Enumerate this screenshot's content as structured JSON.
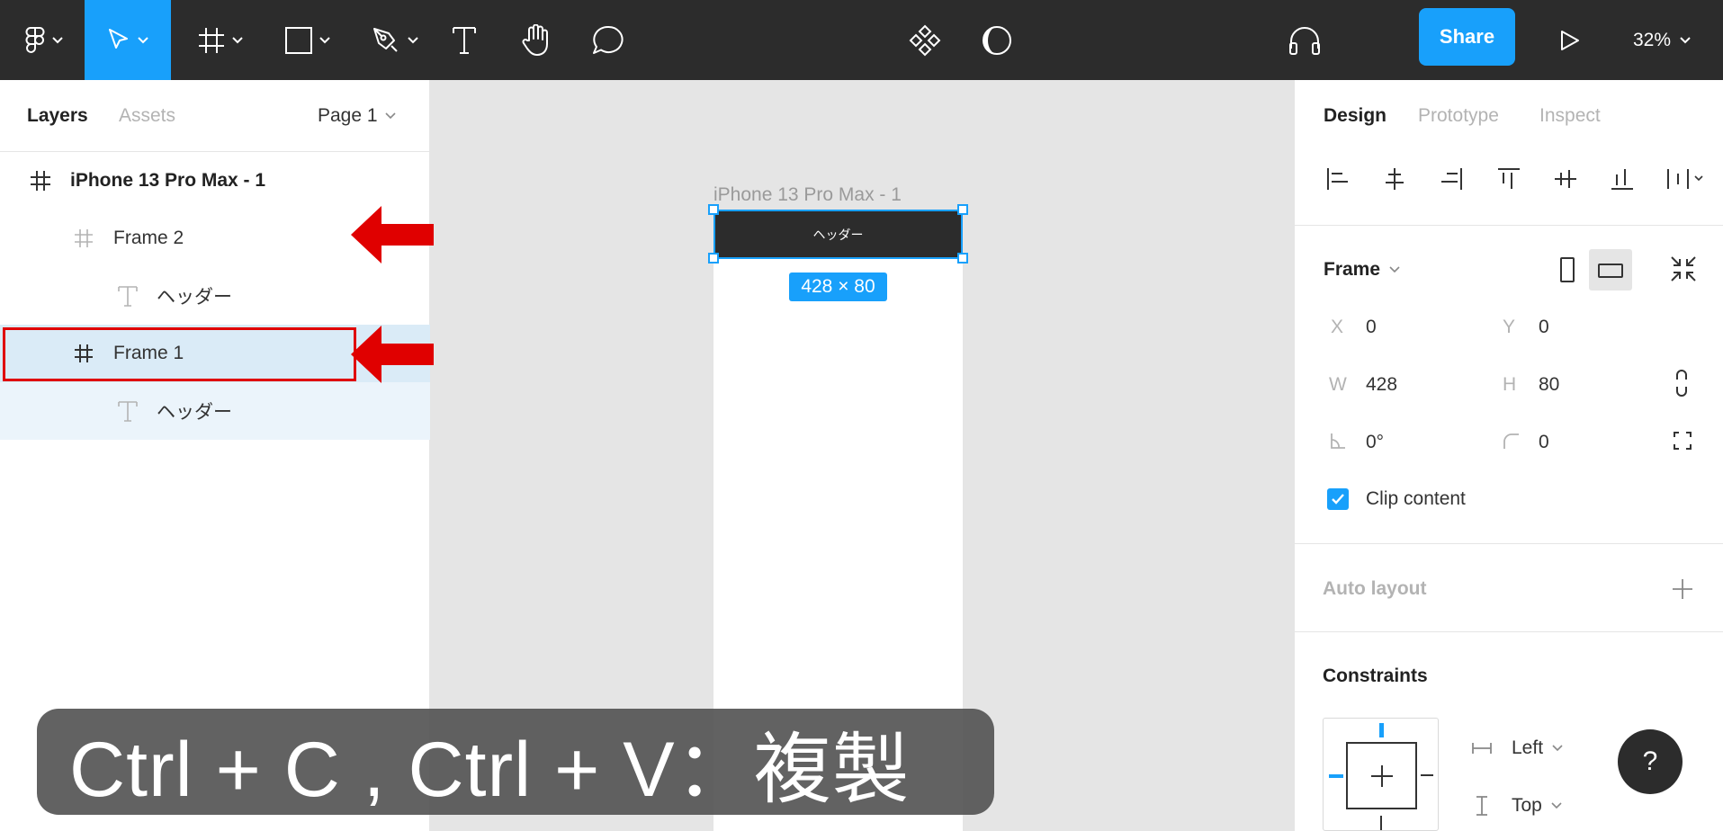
{
  "toolbar": {
    "main_menu_icon": "figma-logo-icon",
    "tools": [
      "move-tool-icon",
      "frame-tool-icon",
      "shape-tool-icon",
      "pen-tool-icon",
      "text-tool-icon",
      "hand-tool-icon",
      "comment-tool-icon"
    ],
    "center_tools": [
      "components-icon",
      "contrast-icon"
    ],
    "audio_icon": "headphones-icon",
    "share_label": "Share",
    "present_icon": "play-icon",
    "zoom_label": "32%",
    "accent_color": "#18a0fb"
  },
  "left_panel": {
    "tabs": {
      "layers": "Layers",
      "assets": "Assets"
    },
    "page_selector": "Page 1",
    "layers": [
      {
        "label": "iPhone 13 Pro Max - 1",
        "type": "frame"
      },
      {
        "label": "Frame 2",
        "type": "frame"
      },
      {
        "label": "ヘッダー",
        "type": "text"
      },
      {
        "label": "Frame 1",
        "type": "frame",
        "selected": true
      },
      {
        "label": "ヘッダー",
        "type": "text"
      }
    ]
  },
  "canvas": {
    "frame_label": "iPhone 13 Pro Max - 1",
    "header_text": "ヘッダー",
    "size_badge": "428 × 80"
  },
  "caption": "Ctrl + C , Ctrl + V：複製",
  "right_panel": {
    "tabs": {
      "design": "Design",
      "prototype": "Prototype",
      "inspect": "Inspect"
    },
    "frame_section": {
      "title": "Frame",
      "x_label": "X",
      "x_value": "0",
      "y_label": "Y",
      "y_value": "0",
      "w_label": "W",
      "w_value": "428",
      "h_label": "H",
      "h_value": "80",
      "rotation_value": "0°",
      "radius_value": "0",
      "clip_content_label": "Clip content",
      "clip_content_checked": true
    },
    "auto_layout_title": "Auto layout",
    "constraints": {
      "title": "Constraints",
      "horizontal": "Left",
      "vertical": "Top"
    },
    "help_label": "?"
  },
  "annotation_color": "#e00000"
}
